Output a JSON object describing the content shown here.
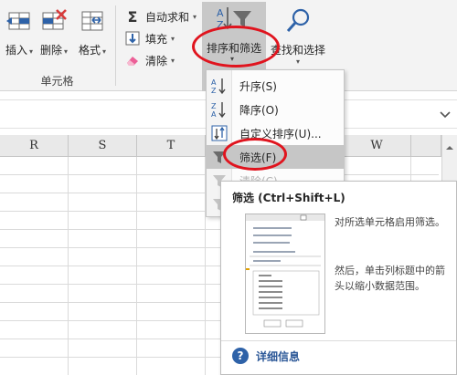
{
  "ribbon": {
    "insert_label": "插入",
    "delete_label": "删除",
    "format_label": "格式",
    "cells_group_label": "单元格",
    "autosum_label": "自动求和",
    "fill_label": "填充",
    "clear_label": "清除",
    "sort_filter_label": "排序和筛选",
    "find_select_label": "查找和选择",
    "dropdown_arrow": "▾",
    "sigma_glyph": "Σ"
  },
  "columns": [
    "R",
    "S",
    "T",
    "W"
  ],
  "sort_menu": {
    "items": [
      {
        "label": "升序(S)",
        "icon": "sort-ascending-icon"
      },
      {
        "label": "降序(O)",
        "icon": "sort-descending-icon"
      },
      {
        "label": "自定义排序(U)...",
        "icon": "custom-sort-icon"
      },
      {
        "label": "筛选(F)",
        "icon": "filter-icon"
      },
      {
        "label": "清除(C)",
        "icon": "clear-filter-icon"
      }
    ]
  },
  "tooltip": {
    "title": "筛选 (Ctrl+Shift+L)",
    "description": "对所选单元格启用筛选。",
    "description_2": "然后，单击列标题中的箭头以缩小数据范围。",
    "more_info": "详细信息",
    "help_glyph": "?"
  },
  "colors": {
    "annotation_red": "#e0141e",
    "ribbon_bg": "#f3f3f3",
    "highlight": "#c6c6c6",
    "link_blue": "#2b5797"
  }
}
